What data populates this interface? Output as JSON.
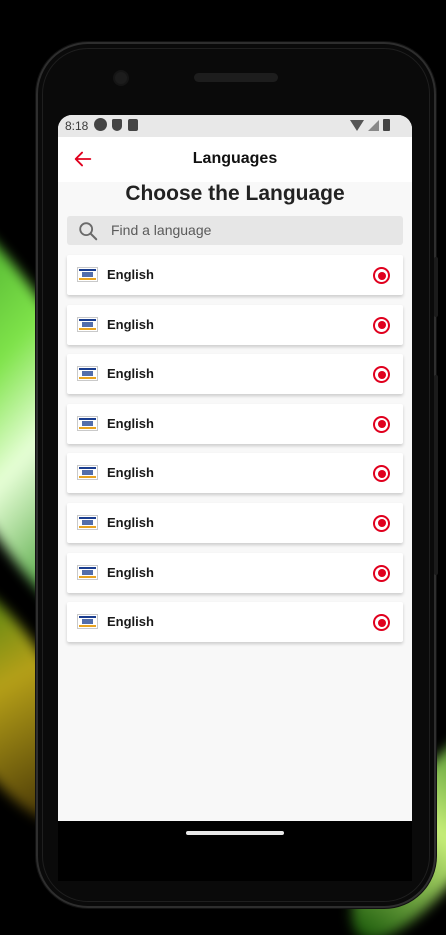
{
  "status_bar": {
    "time": "8:18",
    "left_icons": [
      "gear-icon",
      "shield-icon",
      "sd-card-icon"
    ],
    "right_icons": [
      "wifi-icon",
      "signal-icon",
      "battery-icon"
    ]
  },
  "app_bar": {
    "title": "Languages",
    "back_icon": "arrow-left-icon",
    "accent_color": "#e0001e"
  },
  "heading": "Choose the Language",
  "search": {
    "placeholder": "Find a language",
    "value": "",
    "icon": "search-icon"
  },
  "languages": [
    {
      "label": "English",
      "icon": "visa-card-icon",
      "selected": true
    },
    {
      "label": "English",
      "icon": "visa-card-icon",
      "selected": true
    },
    {
      "label": "English",
      "icon": "visa-card-icon",
      "selected": true
    },
    {
      "label": "English",
      "icon": "visa-card-icon",
      "selected": true
    },
    {
      "label": "English",
      "icon": "visa-card-icon",
      "selected": true
    },
    {
      "label": "English",
      "icon": "visa-card-icon",
      "selected": true
    },
    {
      "label": "English",
      "icon": "visa-card-icon",
      "selected": true
    },
    {
      "label": "English",
      "icon": "visa-card-icon",
      "selected": true
    }
  ]
}
